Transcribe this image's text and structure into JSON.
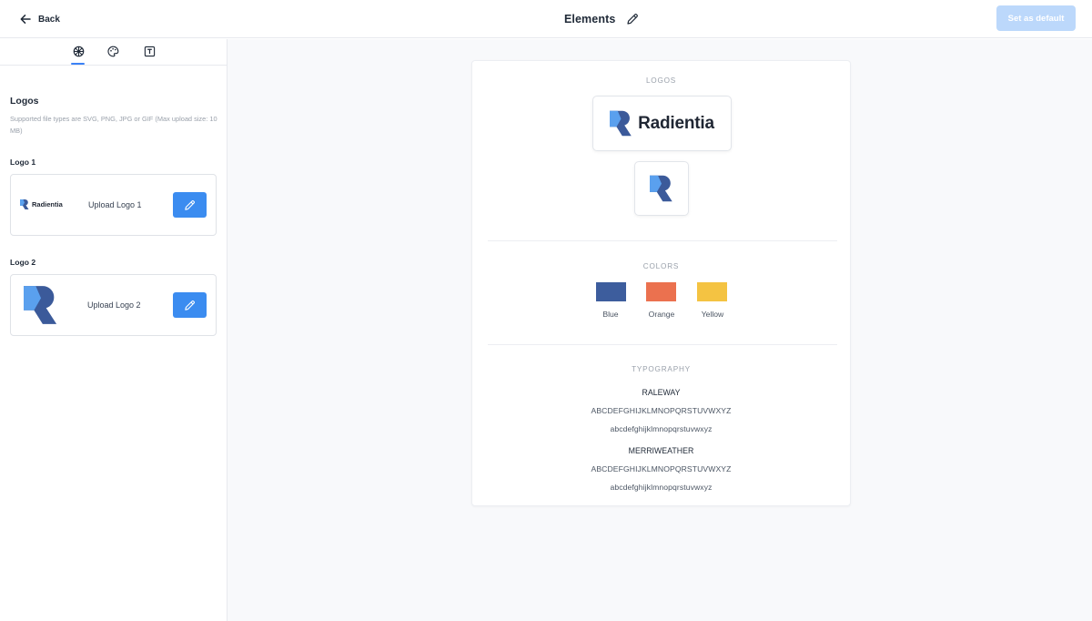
{
  "header": {
    "back_label": "Back",
    "title": "Elements",
    "set_default_label": "Set as default",
    "set_default_color": "#bcd8fb"
  },
  "sidebar": {
    "tabs": [
      {
        "icon": "elements-icon",
        "active": true
      },
      {
        "icon": "palette-icon",
        "active": false
      },
      {
        "icon": "typography-icon",
        "active": false
      }
    ],
    "section_title": "Logos",
    "hint": "Supported file types are SVG, PNG, JPG or GIF (Max upload size: 10 MB)",
    "logos": [
      {
        "label": "Logo 1",
        "upload_text": "Upload Logo 1",
        "thumb_wordmark": "Radientia"
      },
      {
        "label": "Logo 2",
        "upload_text": "Upload Logo 2"
      }
    ]
  },
  "preview": {
    "logos_title": "LOGOS",
    "wordmark": "Radientia",
    "colors_title": "COLORS",
    "colors": [
      {
        "name": "Blue",
        "hex": "#3d5d9d"
      },
      {
        "name": "Orange",
        "hex": "#eb714f"
      },
      {
        "name": "Yellow",
        "hex": "#f4c342"
      }
    ],
    "typography_title": "TYPOGRAPHY",
    "fonts": [
      {
        "name": "RALEWAY",
        "upper": "ABCDEFGHIJKLMNOPQRSTUVWXYZ",
        "lower": "abcdefghijklmnopqrstuvwxyz"
      },
      {
        "name": "MERRIWEATHER",
        "upper": "ABCDEFGHIJKLMNOPQRSTUVWXYZ",
        "lower": "abcdefghijklmnopqrstuvwxyz"
      }
    ]
  },
  "brand_colors": {
    "accent": "#3b8cf0",
    "logo_dark": "#3b5a9a",
    "logo_light": "#5aa0ee"
  }
}
